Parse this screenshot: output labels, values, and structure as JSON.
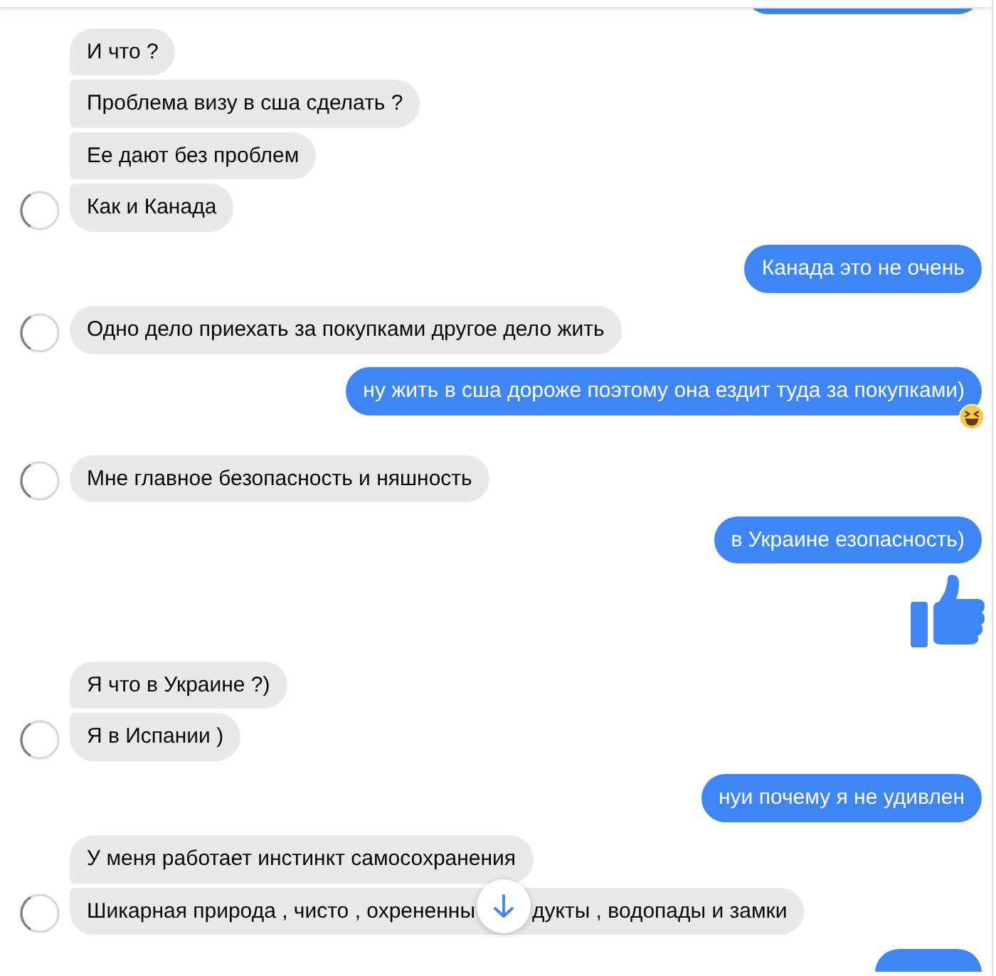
{
  "groups": [
    {
      "kind": "outgoing",
      "messages": [
        {
          "kind": "clipped"
        }
      ]
    },
    {
      "kind": "incoming",
      "messages": [
        {
          "kind": "text",
          "text": "И что ?",
          "reaction": false
        },
        {
          "kind": "text",
          "text": "Проблема визу в сша сделать ?",
          "reaction": false
        },
        {
          "kind": "text",
          "text": "Ее дают без проблем",
          "reaction": false
        },
        {
          "kind": "text",
          "text": "Как и Канада",
          "reaction": false
        }
      ]
    },
    {
      "kind": "outgoing",
      "messages": [
        {
          "kind": "text",
          "text": "Канада это не очень",
          "reaction": false
        }
      ]
    },
    {
      "kind": "incoming",
      "messages": [
        {
          "kind": "text",
          "text": "Одно дело приехать за покупками другое дело жить",
          "reaction": false
        }
      ]
    },
    {
      "kind": "outgoing",
      "messages": [
        {
          "kind": "text",
          "text": "ну жить в сша дороже поэтому она ездит туда за покупками)",
          "reaction": true
        }
      ]
    },
    {
      "kind": "incoming",
      "messages": [
        {
          "kind": "text",
          "text": "Мне главное безопасность и няшность",
          "reaction": false
        }
      ]
    },
    {
      "kind": "outgoing",
      "messages": [
        {
          "kind": "text",
          "text": "в Украине езопасность)",
          "reaction": false
        },
        {
          "kind": "like"
        }
      ]
    },
    {
      "kind": "incoming",
      "messages": [
        {
          "kind": "text",
          "text": "Я что в Украине ?)",
          "reaction": false
        },
        {
          "kind": "text",
          "text": "Я в Испании )",
          "reaction": false
        }
      ]
    },
    {
      "kind": "outgoing",
      "messages": [
        {
          "kind": "text",
          "text": "нуи почему я не удивлен",
          "reaction": false
        }
      ]
    },
    {
      "kind": "incoming",
      "messages": [
        {
          "kind": "text",
          "text": "У меня работает инстинкт самосохранения",
          "reaction": false
        },
        {
          "kind": "split",
          "text": "Шикарная природа , чисто , охрененны",
          "text_after": "дукты , водопады и замки",
          "reaction": false
        }
      ]
    },
    {
      "kind": "outgoing",
      "messages": [
        {
          "kind": "clipped"
        }
      ]
    }
  ],
  "jump_button": {
    "shown": true
  }
}
